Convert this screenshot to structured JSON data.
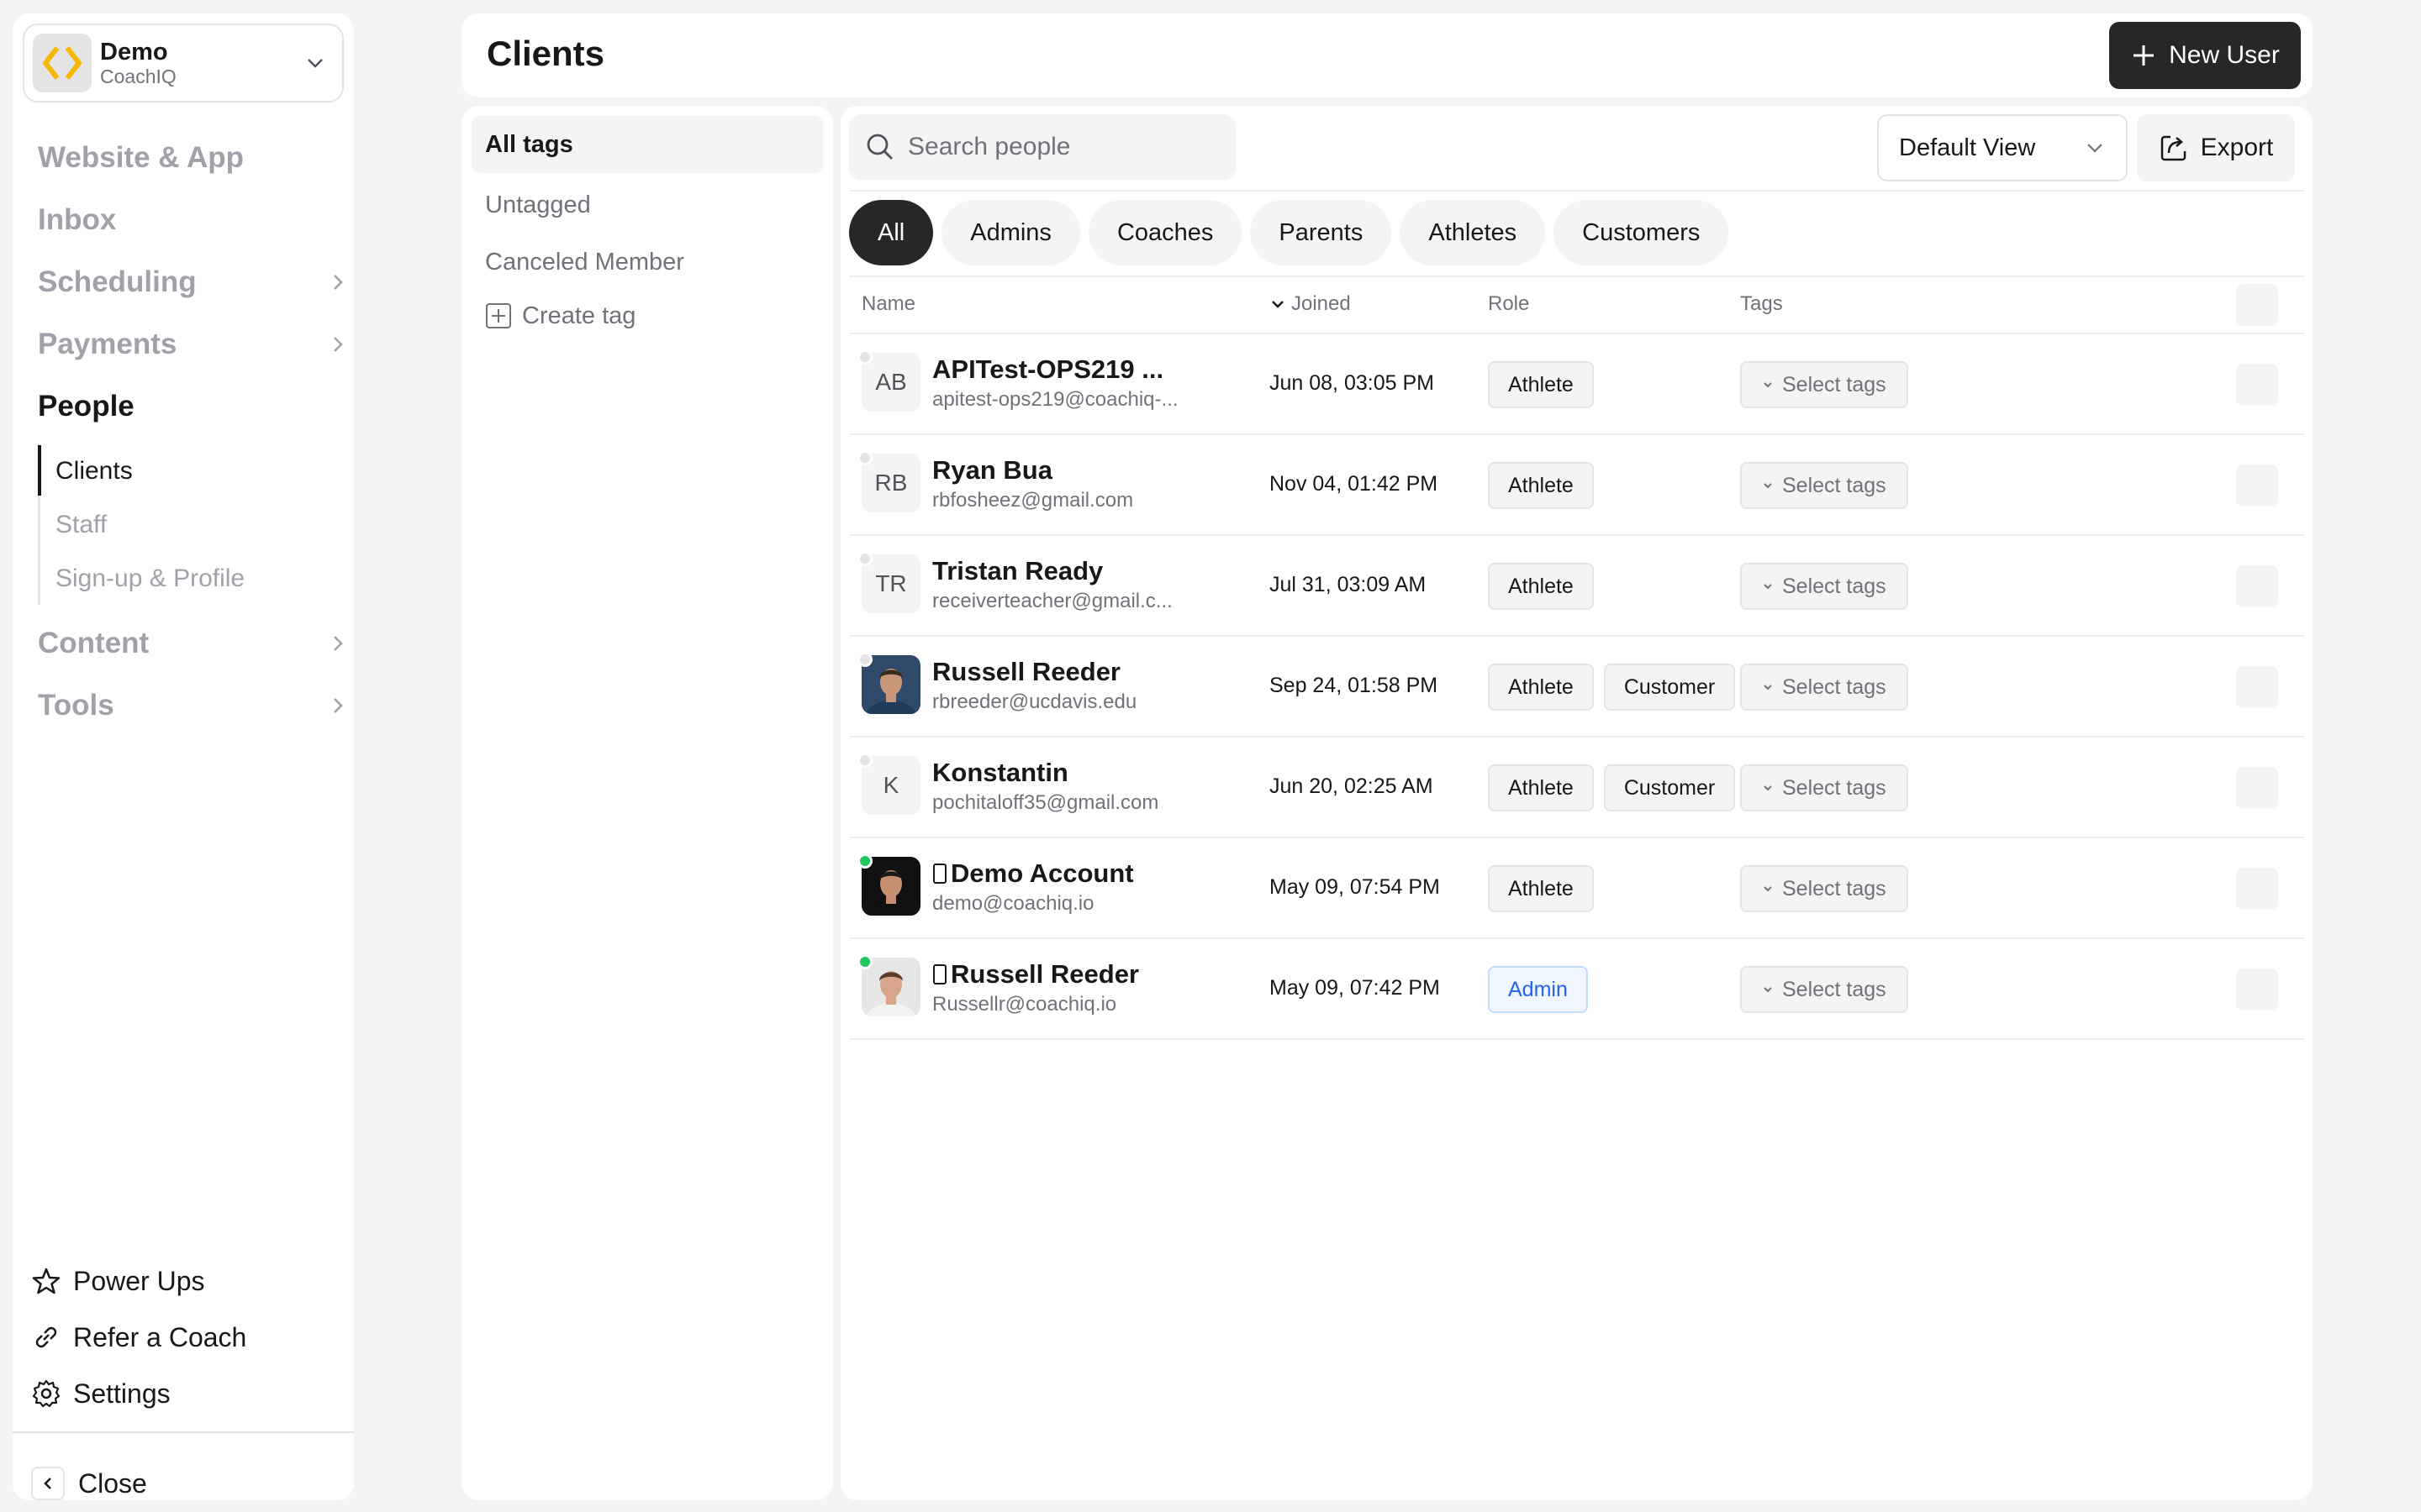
{
  "org": {
    "name": "Demo",
    "sub": "CoachIQ"
  },
  "nav": {
    "website": "Website & App",
    "inbox": "Inbox",
    "scheduling": "Scheduling",
    "payments": "Payments",
    "people": "People",
    "content": "Content",
    "tools": "Tools"
  },
  "people_sub": {
    "clients": "Clients",
    "staff": "Staff",
    "signup": "Sign-up & Profile"
  },
  "bottom": {
    "power_ups": "Power Ups",
    "refer": "Refer a Coach",
    "settings": "Settings",
    "close": "Close"
  },
  "header": {
    "title": "Clients",
    "new_user": "New User"
  },
  "tags": {
    "all": "All tags",
    "untagged": "Untagged",
    "canceled": "Canceled Member",
    "create": "Create tag"
  },
  "search": {
    "placeholder": "Search people"
  },
  "view": {
    "selected": "Default View"
  },
  "export": "Export",
  "filters": [
    "All",
    "Admins",
    "Coaches",
    "Parents",
    "Athletes",
    "Customers"
  ],
  "columns": {
    "name": "Name",
    "joined": "Joined",
    "role": "Role",
    "tags": "Tags"
  },
  "select_tags": "Select tags",
  "users": [
    {
      "initials": "AB",
      "photo": false,
      "online": false,
      "device": false,
      "name": "APITest-OPS219 ...",
      "email": "apitest-ops219@coachiq-...",
      "joined": "Jun 08, 03:05 PM",
      "roles": [
        "Athlete"
      ]
    },
    {
      "initials": "RB",
      "photo": false,
      "online": false,
      "device": false,
      "name": "Ryan Bua",
      "email": "rbfosheez@gmail.com",
      "joined": "Nov 04, 01:42 PM",
      "roles": [
        "Athlete"
      ]
    },
    {
      "initials": "TR",
      "photo": false,
      "online": false,
      "device": false,
      "name": "Tristan Ready",
      "email": "receiverteacher@gmail.c...",
      "joined": "Jul 31, 03:09 AM",
      "roles": [
        "Athlete"
      ]
    },
    {
      "initials": "",
      "photo": true,
      "online": false,
      "device": false,
      "name": "Russell Reeder",
      "email": "rbreeder@ucdavis.edu",
      "joined": "Sep 24, 01:58 PM",
      "roles": [
        "Athlete",
        "Customer"
      ]
    },
    {
      "initials": "K",
      "photo": false,
      "online": false,
      "device": false,
      "name": "Konstantin",
      "email": "pochitaloff35@gmail.com",
      "joined": "Jun 20, 02:25 AM",
      "roles": [
        "Athlete",
        "Customer"
      ]
    },
    {
      "initials": "",
      "photo": true,
      "online": true,
      "device": true,
      "name": "Demo Account",
      "email": "demo@coachiq.io",
      "joined": "May 09, 07:54 PM",
      "roles": [
        "Athlete"
      ]
    },
    {
      "initials": "",
      "photo": true,
      "online": true,
      "device": true,
      "name": "Russell Reeder",
      "email": "Russellr@coachiq.io",
      "joined": "May 09, 07:42 PM",
      "roles": [
        "Admin"
      ]
    }
  ],
  "colors": {
    "accent": "#27272a",
    "online": "#22c55e",
    "admin": "#2563eb",
    "logo": "#f5b800"
  }
}
